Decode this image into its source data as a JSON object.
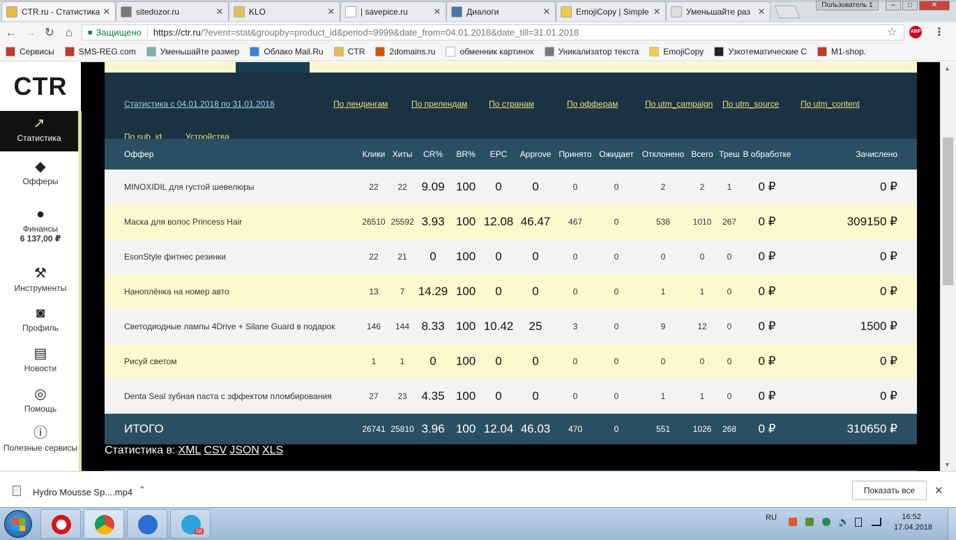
{
  "browser": {
    "tabs": [
      {
        "title": "CTR.ru - Статистика",
        "color": "#e8b94a",
        "icon": "ctr-favicon"
      },
      {
        "title": "sitedozor.ru",
        "color": "#777777",
        "icon": "sitedozor-favicon"
      },
      {
        "title": "KLO",
        "color": "#e0c25a",
        "icon": "klo-favicon"
      },
      {
        "title": "| savepice.ru",
        "color": "#ffffff",
        "icon": "page-favicon"
      },
      {
        "title": "Диалоги",
        "color": "#4a76a8",
        "icon": "vk-favicon"
      },
      {
        "title": "EmojiCopy | Simple",
        "color": "#f2c94c",
        "icon": "emoji-favicon"
      },
      {
        "title": "Уменьшайте раз",
        "color": "#dddddd",
        "icon": "loading-favicon"
      }
    ],
    "user_label": "Пользователь 1",
    "secure_label": "Защищено",
    "url_host": "https://ctr.ru",
    "url_rest": "/?event=stat&groupby=product_id&period=9999&date_from=04.01.2018&date_till=31.01.2018",
    "bookmarks": [
      {
        "label": "Сервисы",
        "color": "#c0392b"
      },
      {
        "label": "SMS-REG.com",
        "color": "#c0392b"
      },
      {
        "label": "Уменьшайте размер",
        "color": "#7fb3a0"
      },
      {
        "label": "Облако Mail.Ru",
        "color": "#2e86de"
      },
      {
        "label": "CTR",
        "color": "#e8b94a"
      },
      {
        "label": "2domains.ru",
        "color": "#d35400"
      },
      {
        "label": "обменник картинок",
        "color": "#ffffff"
      },
      {
        "label": "Уникализатор текста",
        "color": "#777777"
      },
      {
        "label": "EmojiCopy",
        "color": "#f2c94c"
      },
      {
        "label": "Узкотематические С",
        "color": "#222222"
      },
      {
        "label": "M1-shop.",
        "color": "#c0392b"
      }
    ]
  },
  "sidebar": {
    "logo": "CTR",
    "items": [
      {
        "label": "Статистика",
        "icon": "chart-icon",
        "active": true
      },
      {
        "label": "Офферы",
        "icon": "tag-icon"
      },
      {
        "label": "Финансы",
        "icon": "money-bag-icon",
        "sub": "6 137,00 ₽"
      },
      {
        "label": "Инструменты",
        "icon": "wrench-icon"
      },
      {
        "label": "Профиль",
        "icon": "users-icon"
      },
      {
        "label": "Новости",
        "icon": "news-icon"
      },
      {
        "label": "Помощь",
        "icon": "compass-icon"
      },
      {
        "label": "Полезные сервисы",
        "icon": "info-icon"
      }
    ]
  },
  "filters": {
    "period_link": "Статистика с 04.01.2018 по 31.01.2018",
    "links_row1": [
      "По лендингам",
      "По прелендам",
      "По странам",
      "По офферам",
      "По utm_campaign",
      "По utm_source",
      "По utm_content"
    ],
    "links_row2": [
      "По sub_id",
      "Устройства"
    ]
  },
  "table": {
    "headers": [
      "Оффер",
      "Клики",
      "Хиты",
      "CR%",
      "BR%",
      "EPC",
      "Approve",
      "Принято",
      "Ожидает",
      "Отклонено",
      "Всего",
      "Треш",
      "В обработке",
      "Зачислено"
    ],
    "rows": [
      [
        "MINOXIDIL для густой шевелюры",
        "22",
        "22",
        "9.09",
        "100",
        "0",
        "0",
        "0",
        "0",
        "2",
        "2",
        "1",
        "0 ₽",
        "0 ₽"
      ],
      [
        "Маска для волос Princess Hair",
        "26510",
        "25592",
        "3.93",
        "100",
        "12.08",
        "46.47",
        "467",
        "0",
        "538",
        "1010",
        "267",
        "0 ₽",
        "309150 ₽"
      ],
      [
        "EsonStyle фитнес резинки",
        "22",
        "21",
        "0",
        "100",
        "0",
        "0",
        "0",
        "0",
        "0",
        "0",
        "0",
        "0 ₽",
        "0 ₽"
      ],
      [
        "Наноплёнка на номер авто",
        "13",
        "7",
        "14.29",
        "100",
        "0",
        "0",
        "0",
        "0",
        "1",
        "1",
        "0",
        "0 ₽",
        "0 ₽"
      ],
      [
        "Светодиодные лампы 4Drive + Silane Guard в подарок",
        "146",
        "144",
        "8.33",
        "100",
        "10.42",
        "25",
        "3",
        "0",
        "9",
        "12",
        "0",
        "0 ₽",
        "1500 ₽"
      ],
      [
        "Рисуй светом",
        "1",
        "1",
        "0",
        "100",
        "0",
        "0",
        "0",
        "0",
        "0",
        "0",
        "0",
        "0 ₽",
        "0 ₽"
      ],
      [
        "Denta Seal зубная паста с эффектом пломбирования",
        "27",
        "23",
        "4.35",
        "100",
        "0",
        "0",
        "0",
        "0",
        "1",
        "1",
        "0",
        "0 ₽",
        "0 ₽"
      ]
    ],
    "total": [
      "ИТОГО",
      "26741",
      "25810",
      "3.96",
      "100",
      "12.04",
      "46.03",
      "470",
      "0",
      "551",
      "1026",
      "268",
      "0 ₽",
      "310650 ₽"
    ]
  },
  "exports": {
    "label": "Статистика в:",
    "formats": [
      "XML",
      "CSV",
      "JSON",
      "XLS"
    ]
  },
  "downloads": {
    "file": "Hydro Mousse Sp....mp4",
    "show_all": "Показать все"
  },
  "taskbar": {
    "lang": "RU",
    "telegram_badge": "58",
    "time": "16:52",
    "date": "17.04.2018"
  }
}
